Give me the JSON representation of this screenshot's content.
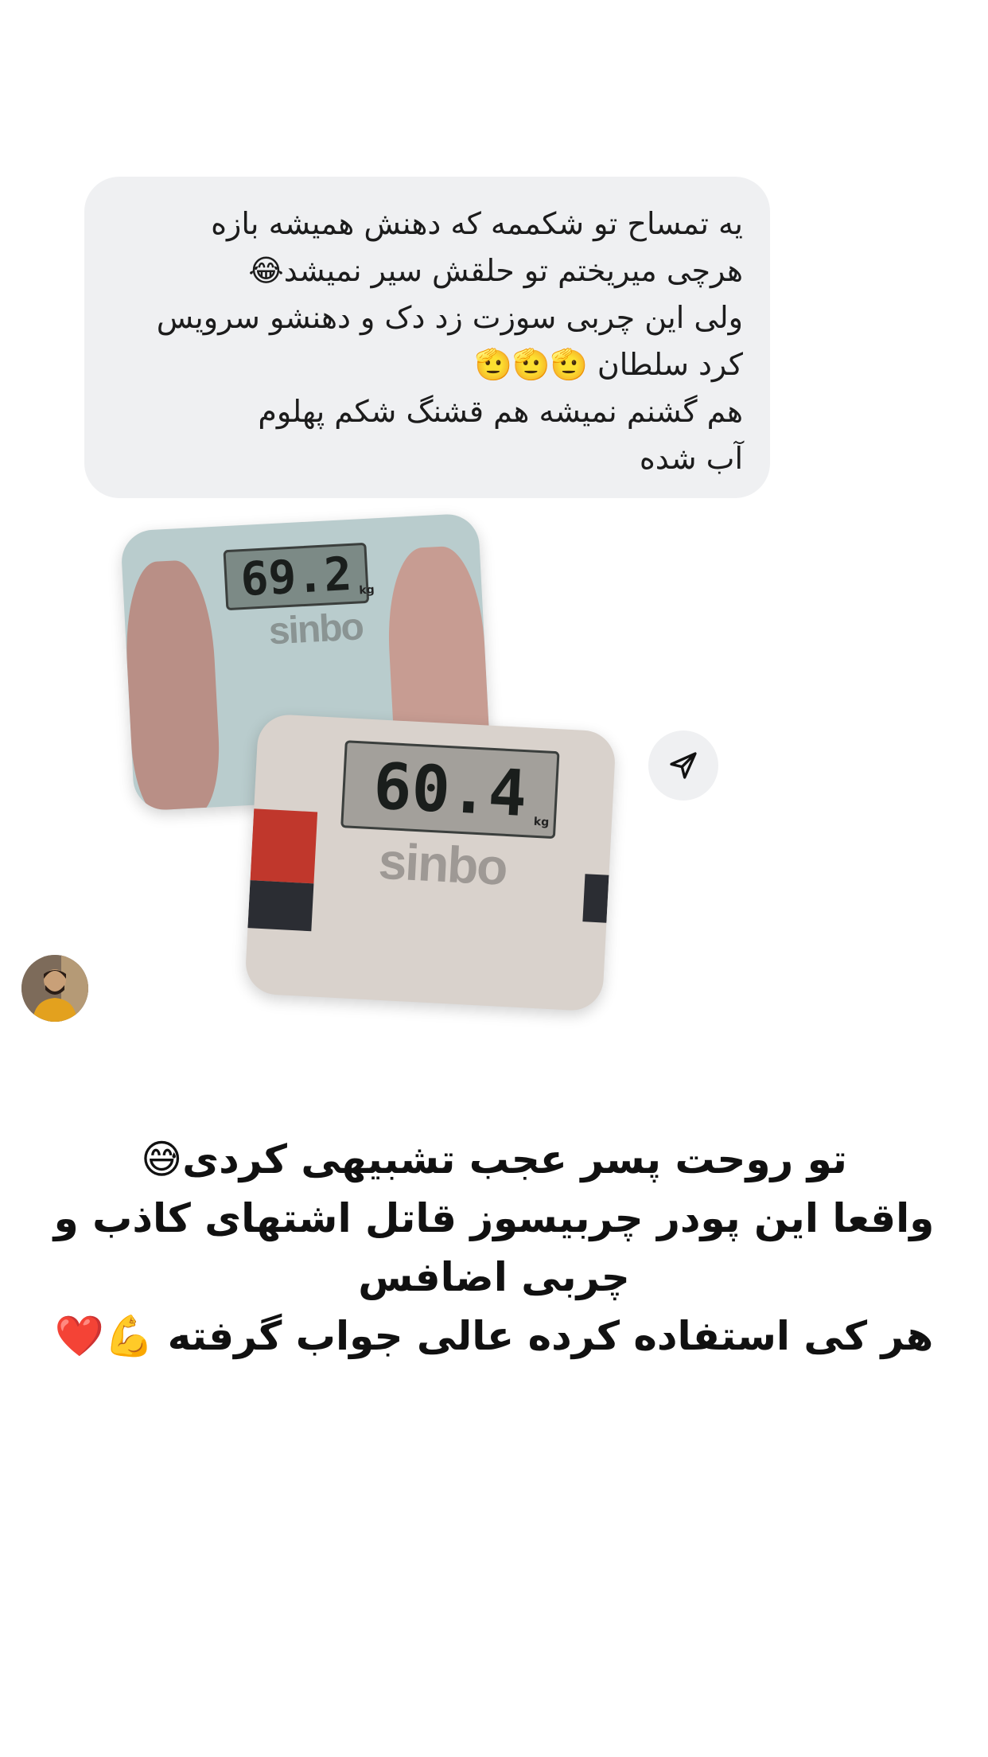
{
  "message": {
    "lines": [
      "یه تمساح تو شکممه که دهنش همیشه بازه",
      "هرچی میریختم تو حلقش سیر نمیشد😂",
      "ولی این چربی سوزت زد دک و دهنشو سرویس",
      "کرد سلطان 🫡🫡🫡",
      "هم گشنم نمیشه هم قشنگ شکم پهلوم",
      "آب شده"
    ]
  },
  "photos": {
    "before_reading": "69.2",
    "before_brand": "sinbo",
    "after_reading": "60.4",
    "after_brand": "sinbo",
    "unit": "kg"
  },
  "caption": {
    "lines": [
      "تو روحت پسر عجب تشبیهی کردی😅",
      "واقعا این پودر چربیسوز قاتل اشتهای کاذب و",
      "چربی اضافس",
      "هر کی استفاده کرده عالی جواب گرفته 💪❤️"
    ]
  },
  "icons": {
    "share": "send-icon",
    "avatar": "profile-avatar"
  }
}
